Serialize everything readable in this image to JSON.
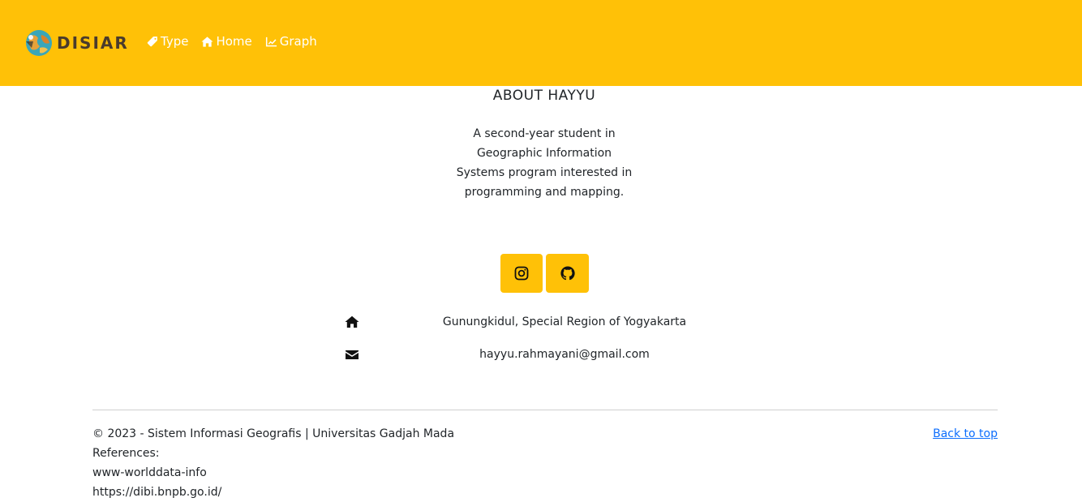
{
  "navbar": {
    "brand": "DISIAR",
    "links": [
      {
        "label": "Type",
        "icon": "tag-icon"
      },
      {
        "label": "Home",
        "icon": "home-icon"
      },
      {
        "label": "Graph",
        "icon": "chart-line-icon"
      }
    ],
    "background": "#ffc107"
  },
  "about": {
    "title": "ABOUT HAYYU",
    "description": "A second-year student in Geographic Information Systems program interested in programming and mapping."
  },
  "social": [
    {
      "icon": "instagram-icon"
    },
    {
      "icon": "github-icon"
    }
  ],
  "contact": {
    "address": "Gunungkidul, Special Region of Yogyakarta",
    "email": "hayyu.rahmayani@gmail.com"
  },
  "footer": {
    "copyright": "© 2023 - Sistem Informasi Geografis | Universitas Gadjah Mada",
    "references_label": "References:",
    "references": [
      "www-worlddata-info",
      "https://dibi.bnpb.go.id/"
    ],
    "back_to_top": "Back to top",
    "link_color": "#0d6efd"
  }
}
